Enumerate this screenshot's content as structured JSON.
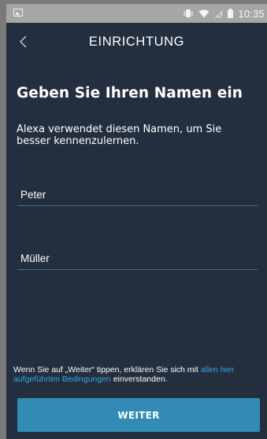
{
  "status_bar": {
    "time": "10:35",
    "icons": [
      "image-notification-icon",
      "vibrate-icon",
      "wifi-icon",
      "signal-off-icon",
      "battery-icon"
    ]
  },
  "header": {
    "back_icon": "chevron-left-icon",
    "title": "EINRICHTUNG"
  },
  "main": {
    "title": "Geben Sie Ihren Namen ein",
    "description": "Alexa verwendet diesen Namen, um Sie besser kennenzulernen.",
    "first_name_value": "Peter",
    "last_name_value": "Müller"
  },
  "footer": {
    "terms_prefix": "Wenn Sie auf „Weiter“ tippen, erklären Sie sich mit ",
    "terms_link": "allen hier aufgeführten Bedingungen",
    "terms_suffix": " einverstanden.",
    "button_label": "WEITER"
  },
  "colors": {
    "background": "#232f3e",
    "status_bar": "#a6a6a6",
    "accent_button": "#318bb4",
    "link": "#31a7e0"
  }
}
